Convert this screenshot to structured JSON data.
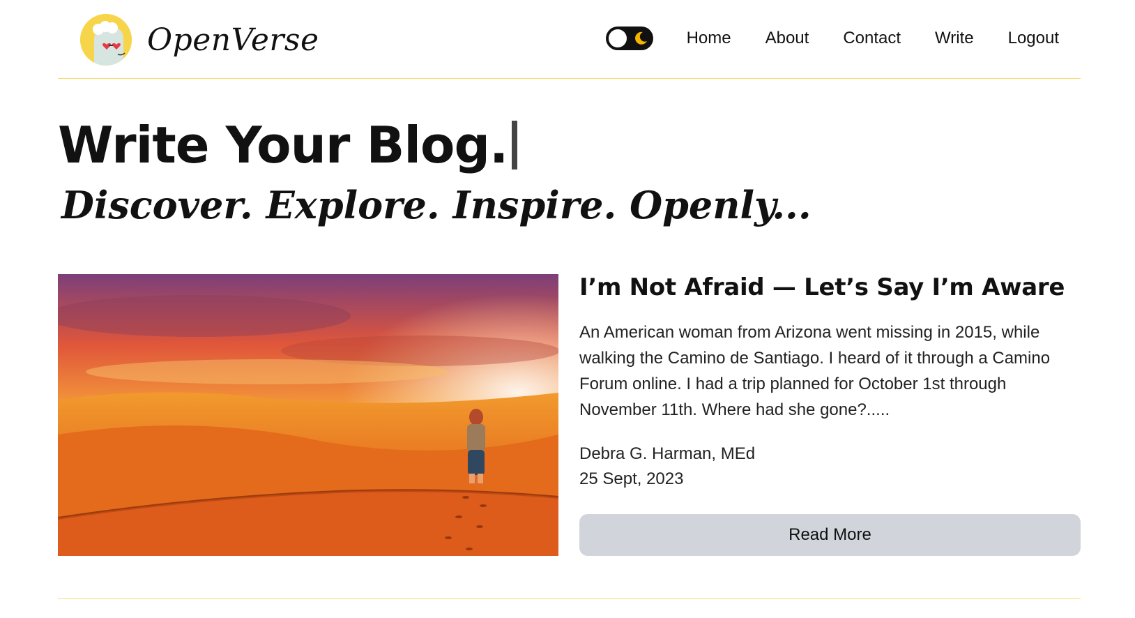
{
  "brand": {
    "name": "OpenVerse",
    "logo_icon": "llama-with-heart-glasses-icon",
    "accent": "#f7dc6f"
  },
  "nav": {
    "theme_toggle_icon": "moon-icon",
    "items": [
      {
        "label": "Home"
      },
      {
        "label": "About"
      },
      {
        "label": "Contact"
      },
      {
        "label": "Write"
      },
      {
        "label": "Logout"
      }
    ]
  },
  "hero": {
    "title": "Write Your Blog.",
    "subtitle": "Discover. Explore. Inspire. Openly..."
  },
  "post": {
    "title": "I’m Not Afraid — Let’s Say I’m Aware",
    "excerpt": "An American woman from Arizona went missing in 2015, while walking the Camino de Santiago. I heard of it through a Camino Forum online. I had a trip planned for October 1st through November 11th. Where had she gone?.....",
    "author": "Debra G. Harman, MEd",
    "date": "25 Sept, 2023",
    "read_more_label": "Read More",
    "image_alt": "desert-walker-image"
  }
}
